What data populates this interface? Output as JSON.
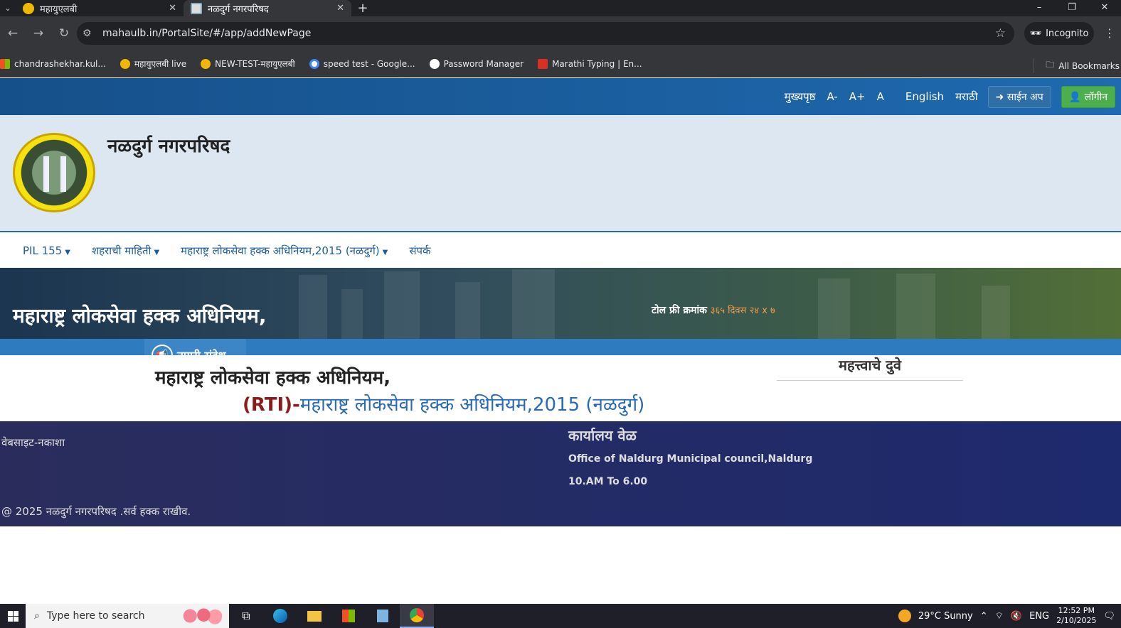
{
  "browser": {
    "tabs": [
      {
        "title": "महायुएलबी",
        "active": false
      },
      {
        "title": "नळदुर्ग नगरपरिषद",
        "active": true
      }
    ],
    "new_tab": "+",
    "window_controls": [
      "–",
      "❐",
      "✕"
    ],
    "url": "mahaulb.in/PortalSite/#/app/addNewPage",
    "incognito_label": "Incognito",
    "bookmarks": [
      {
        "label": "chandrashekhar.kul...",
        "color": "#4285f4"
      },
      {
        "label": "महायुएलबी live",
        "color": "#f2b705"
      },
      {
        "label": "NEW-TEST-महायुएलबी",
        "color": "#f2b705"
      },
      {
        "label": "speed test - Google...",
        "color": "#ffffff"
      },
      {
        "label": "Password Manager",
        "color": "#ffffff"
      },
      {
        "label": "Marathi Typing | En...",
        "color": "#d93025"
      }
    ],
    "all_bookmarks": "All Bookmarks"
  },
  "site": {
    "topbar": {
      "home": "मुख्यपृष्ठ",
      "font_minus": "A-",
      "font_plus": "A+",
      "font_normal": "A",
      "english": "English",
      "marathi": "मराठी",
      "signup": "साईन अप",
      "login": "लॉगीन"
    },
    "name": "नळदुर्ग नगरपरिषद",
    "nav": [
      "PIL 155",
      "शहराची माहिती",
      "महाराष्ट्र लोकसेवा हक्क अधिनियम,2015 (नळदुर्ग)",
      "संपर्क"
    ],
    "banner_title": "महाराष्ट्र लोकसेवा हक्क अधिनियम,",
    "toll_label": "टोल फ्री क्रमांक",
    "toll_value": "३६५ दिवस २४ x ७",
    "notice_tag": "नागरी संदेश",
    "content_heading": "महाराष्ट्र लोकसेवा हक्क अधिनियम,",
    "rti_prefix": "(RTI)-",
    "rti_link": "महाराष्ट्र लोकसेवा हक्क अधिनियम,2015 (नळदुर्ग)",
    "important_links": "महत्त्वाचे दुवे",
    "footer": {
      "sitemap": "वेबसाइट-नकाशा",
      "office_hours_title": "कार्यालय वेळ",
      "office_name": "Office of Naldurg Municipal council,Naldurg",
      "hours": "10.AM To 6.00",
      "copyright": "@ 2025 नळदुर्ग नगरपरिषद .सर्व हक्क राखीव."
    }
  },
  "taskbar": {
    "search_placeholder": "Type here to search",
    "weather": "29°C  Sunny",
    "language": "ENG",
    "time": "12:52 PM",
    "date": "2/10/2025"
  }
}
